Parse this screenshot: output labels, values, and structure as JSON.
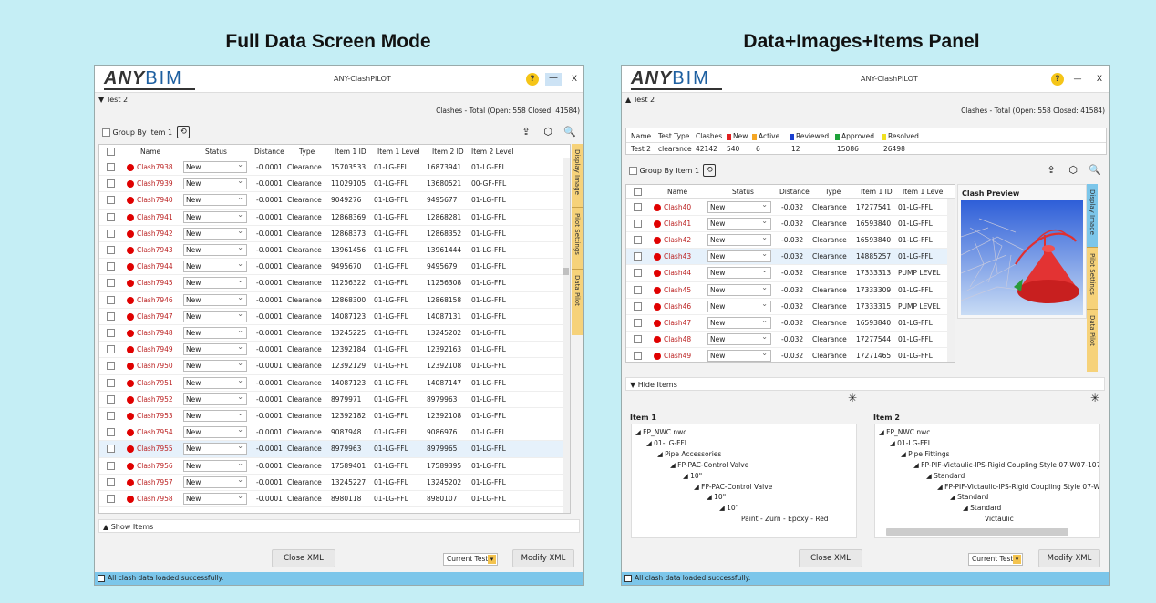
{
  "headings": {
    "left": "Full Data Screen Mode",
    "right": "Data+Images+Items Panel"
  },
  "app": {
    "logo_any": "ANY",
    "logo_bim": "BIM",
    "title": "ANY-ClashPILOT",
    "help": "?",
    "minimize": "—",
    "close": "X",
    "test_left": "▼ Test 2",
    "test_right": "▲ Test 2",
    "totals": "Clashes - Total (Open: 558 Closed: 41584)",
    "group_by": "Group By Item 1",
    "refresh_icon": "⟲",
    "export_icon": "⇪",
    "cube_icon": "⬡",
    "zoom_icon": "🔍",
    "colors": {
      "accent_tab": "#f6d27a",
      "status_bar": "#7cc6ea",
      "clash_dot": "#e00000"
    }
  },
  "columns_left": [
    "Name",
    "Status",
    "Distance",
    "Type",
    "Item 1 ID",
    "Item 1 Level",
    "Item 2 ID",
    "Item 2 Level"
  ],
  "rows_left": [
    {
      "name": "Clash7938",
      "status": "New",
      "distance": "-0.0001",
      "type": "Clearance",
      "i1id": "15703533",
      "i1lvl": "01-LG-FFL",
      "i2id": "16873941",
      "i2lvl": "01-LG-FFL"
    },
    {
      "name": "Clash7939",
      "status": "New",
      "distance": "-0.0001",
      "type": "Clearance",
      "i1id": "11029105",
      "i1lvl": "01-LG-FFL",
      "i2id": "13680521",
      "i2lvl": "00-GF-FFL"
    },
    {
      "name": "Clash7940",
      "status": "New",
      "distance": "-0.0001",
      "type": "Clearance",
      "i1id": "9049276",
      "i1lvl": "01-LG-FFL",
      "i2id": "9495677",
      "i2lvl": "01-LG-FFL"
    },
    {
      "name": "Clash7941",
      "status": "New",
      "distance": "-0.0001",
      "type": "Clearance",
      "i1id": "12868369",
      "i1lvl": "01-LG-FFL",
      "i2id": "12868281",
      "i2lvl": "01-LG-FFL"
    },
    {
      "name": "Clash7942",
      "status": "New",
      "distance": "-0.0001",
      "type": "Clearance",
      "i1id": "12868373",
      "i1lvl": "01-LG-FFL",
      "i2id": "12868352",
      "i2lvl": "01-LG-FFL"
    },
    {
      "name": "Clash7943",
      "status": "New",
      "distance": "-0.0001",
      "type": "Clearance",
      "i1id": "13961456",
      "i1lvl": "01-LG-FFL",
      "i2id": "13961444",
      "i2lvl": "01-LG-FFL"
    },
    {
      "name": "Clash7944",
      "status": "New",
      "distance": "-0.0001",
      "type": "Clearance",
      "i1id": "9495670",
      "i1lvl": "01-LG-FFL",
      "i2id": "9495679",
      "i2lvl": "01-LG-FFL"
    },
    {
      "name": "Clash7945",
      "status": "New",
      "distance": "-0.0001",
      "type": "Clearance",
      "i1id": "11256322",
      "i1lvl": "01-LG-FFL",
      "i2id": "11256308",
      "i2lvl": "01-LG-FFL"
    },
    {
      "name": "Clash7946",
      "status": "New",
      "distance": "-0.0001",
      "type": "Clearance",
      "i1id": "12868300",
      "i1lvl": "01-LG-FFL",
      "i2id": "12868158",
      "i2lvl": "01-LG-FFL"
    },
    {
      "name": "Clash7947",
      "status": "New",
      "distance": "-0.0001",
      "type": "Clearance",
      "i1id": "14087123",
      "i1lvl": "01-LG-FFL",
      "i2id": "14087131",
      "i2lvl": "01-LG-FFL"
    },
    {
      "name": "Clash7948",
      "status": "New",
      "distance": "-0.0001",
      "type": "Clearance",
      "i1id": "13245225",
      "i1lvl": "01-LG-FFL",
      "i2id": "13245202",
      "i2lvl": "01-LG-FFL"
    },
    {
      "name": "Clash7949",
      "status": "New",
      "distance": "-0.0001",
      "type": "Clearance",
      "i1id": "12392184",
      "i1lvl": "01-LG-FFL",
      "i2id": "12392163",
      "i2lvl": "01-LG-FFL"
    },
    {
      "name": "Clash7950",
      "status": "New",
      "distance": "-0.0001",
      "type": "Clearance",
      "i1id": "12392129",
      "i1lvl": "01-LG-FFL",
      "i2id": "12392108",
      "i2lvl": "01-LG-FFL"
    },
    {
      "name": "Clash7951",
      "status": "New",
      "distance": "-0.0001",
      "type": "Clearance",
      "i1id": "14087123",
      "i1lvl": "01-LG-FFL",
      "i2id": "14087147",
      "i2lvl": "01-LG-FFL"
    },
    {
      "name": "Clash7952",
      "status": "New",
      "distance": "-0.0001",
      "type": "Clearance",
      "i1id": "8979971",
      "i1lvl": "01-LG-FFL",
      "i2id": "8979963",
      "i2lvl": "01-LG-FFL"
    },
    {
      "name": "Clash7953",
      "status": "New",
      "distance": "-0.0001",
      "type": "Clearance",
      "i1id": "12392182",
      "i1lvl": "01-LG-FFL",
      "i2id": "12392108",
      "i2lvl": "01-LG-FFL"
    },
    {
      "name": "Clash7954",
      "status": "New",
      "distance": "-0.0001",
      "type": "Clearance",
      "i1id": "9087948",
      "i1lvl": "01-LG-FFL",
      "i2id": "9086976",
      "i2lvl": "01-LG-FFL"
    },
    {
      "name": "Clash7955",
      "status": "New",
      "distance": "-0.0001",
      "type": "Clearance",
      "i1id": "8979963",
      "i1lvl": "01-LG-FFL",
      "i2id": "8979965",
      "i2lvl": "01-LG-FFL"
    },
    {
      "name": "Clash7956",
      "status": "New",
      "distance": "-0.0001",
      "type": "Clearance",
      "i1id": "17589401",
      "i1lvl": "01-LG-FFL",
      "i2id": "17589395",
      "i2lvl": "01-LG-FFL"
    },
    {
      "name": "Clash7957",
      "status": "New",
      "distance": "-0.0001",
      "type": "Clearance",
      "i1id": "13245227",
      "i1lvl": "01-LG-FFL",
      "i2id": "13245202",
      "i2lvl": "01-LG-FFL"
    },
    {
      "name": "Clash7958",
      "status": "New",
      "distance": "-0.0001",
      "type": "Clearance",
      "i1id": "8980118",
      "i1lvl": "01-LG-FFL",
      "i2id": "8980107",
      "i2lvl": "01-LG-FFL"
    }
  ],
  "side_tabs": [
    "Display Image",
    "Pilot Settings",
    "Data Pilot"
  ],
  "show_items": "▲ Show Items",
  "hide_items": "▼ Hide Items",
  "close_xml": "Close XML",
  "modify_xml": "Modify XML",
  "current_test": "Current Test",
  "status_msg": "All clash data loaded successfully.",
  "summary": {
    "headers": [
      "Name",
      "Test Type",
      "Clashes",
      "New",
      "Active",
      "Reviewed",
      "Approved",
      "Resolved"
    ],
    "legend_colors": [
      "#e02020",
      "#f5a623",
      "#1a3fd0",
      "#1ea23a",
      "#f0e020"
    ],
    "values": [
      "Test 2",
      "clearance",
      "42142",
      "540",
      "6",
      "12",
      "15086",
      "26498"
    ]
  },
  "columns_right": [
    "Name",
    "Status",
    "Distance",
    "Type",
    "Item 1 ID",
    "Item 1 Level"
  ],
  "rows_right": [
    {
      "name": "Clash40",
      "status": "New",
      "distance": "-0.032",
      "type": "Clearance",
      "i1id": "17277541",
      "i1lvl": "01-LG-FFL"
    },
    {
      "name": "Clash41",
      "status": "New",
      "distance": "-0.032",
      "type": "Clearance",
      "i1id": "16593840",
      "i1lvl": "01-LG-FFL"
    },
    {
      "name": "Clash42",
      "status": "New",
      "distance": "-0.032",
      "type": "Clearance",
      "i1id": "16593840",
      "i1lvl": "01-LG-FFL"
    },
    {
      "name": "Clash43",
      "status": "New",
      "distance": "-0.032",
      "type": "Clearance",
      "i1id": "14885257",
      "i1lvl": "01-LG-FFL"
    },
    {
      "name": "Clash44",
      "status": "New",
      "distance": "-0.032",
      "type": "Clearance",
      "i1id": "17333313",
      "i1lvl": "PUMP LEVEL"
    },
    {
      "name": "Clash45",
      "status": "New",
      "distance": "-0.032",
      "type": "Clearance",
      "i1id": "17333309",
      "i1lvl": "01-LG-FFL"
    },
    {
      "name": "Clash46",
      "status": "New",
      "distance": "-0.032",
      "type": "Clearance",
      "i1id": "17333315",
      "i1lvl": "PUMP LEVEL"
    },
    {
      "name": "Clash47",
      "status": "New",
      "distance": "-0.032",
      "type": "Clearance",
      "i1id": "16593840",
      "i1lvl": "01-LG-FFL"
    },
    {
      "name": "Clash48",
      "status": "New",
      "distance": "-0.032",
      "type": "Clearance",
      "i1id": "17277544",
      "i1lvl": "01-LG-FFL"
    },
    {
      "name": "Clash49",
      "status": "New",
      "distance": "-0.032",
      "type": "Clearance",
      "i1id": "17271465",
      "i1lvl": "01-LG-FFL"
    }
  ],
  "clash_preview": "Clash Preview",
  "item1": {
    "title": "Item 1",
    "tree": [
      "◢ FP_NWC.nwc",
      "◢ 01-LG-FFL",
      "◢ Pipe Accessories",
      "◢ FP-PAC-Control Valve",
      "◢ 10\"",
      "◢ FP-PAC-Control Valve",
      "◢ 10\"",
      "◢ 10\"",
      "Paint - Zurn - Epoxy - Red"
    ]
  },
  "item2": {
    "title": "Item 2",
    "tree": [
      "◢ FP_NWC.nwc",
      "◢ 01-LG-FFL",
      "◢ Pipe Fittings",
      "◢ FP-PIF-Victaulic-IPS-Rigid Coupling Style 07-W07-107",
      "◢ Standard",
      "◢ FP-PIF-Victaulic-IPS-Rigid Coupling Style 07-W0",
      "◢ Standard",
      "◢ Standard",
      "Victaulic"
    ]
  }
}
